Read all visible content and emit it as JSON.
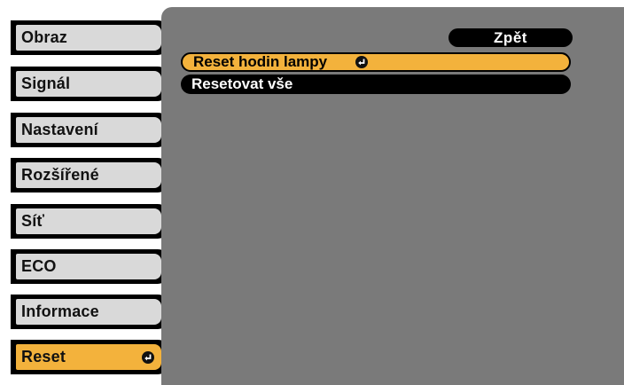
{
  "sidebar": {
    "items": [
      {
        "label": "Obraz"
      },
      {
        "label": "Signál"
      },
      {
        "label": "Nastavení"
      },
      {
        "label": "Rozšířené"
      },
      {
        "label": "Síť"
      },
      {
        "label": "ECO"
      },
      {
        "label": "Informace"
      },
      {
        "label": "Reset",
        "active": true,
        "icon": "enter-icon"
      }
    ]
  },
  "main": {
    "back_label": "Zpět",
    "menu": [
      {
        "label": "Reset hodin lampy",
        "selected": true,
        "icon": "enter-icon"
      },
      {
        "label": "Resetovat vše",
        "selected": false
      }
    ]
  },
  "colors": {
    "accent": "#f3b23c",
    "panel": "#7a7a7a",
    "tab": "#d9d9d9"
  }
}
